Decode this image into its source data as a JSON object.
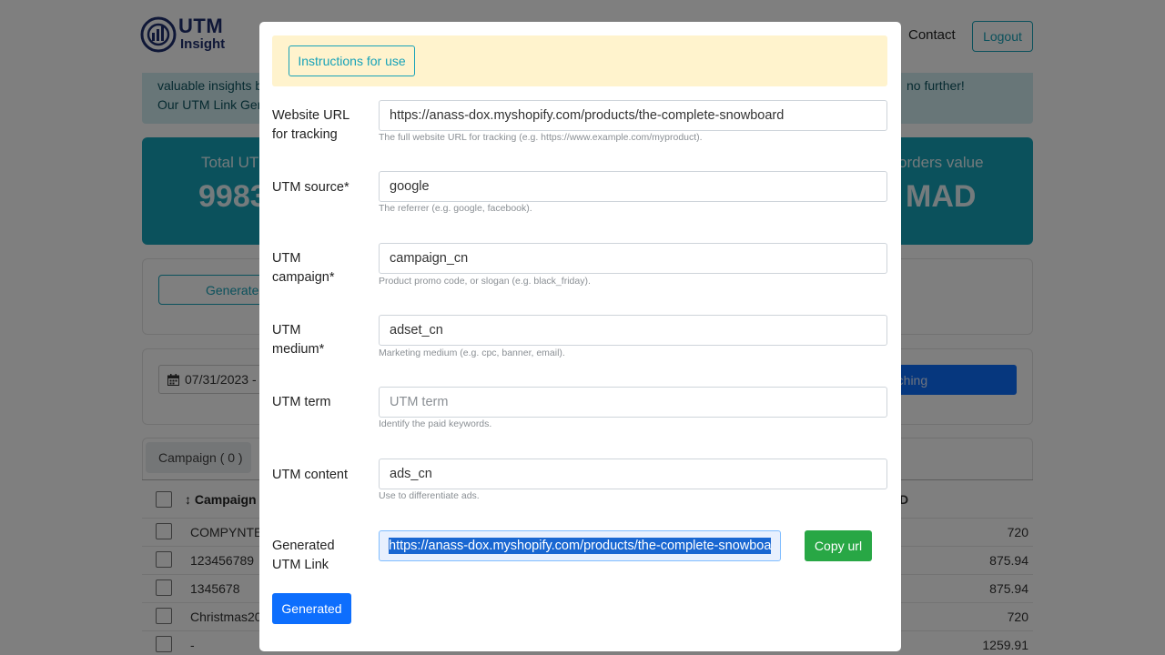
{
  "header": {
    "logo_line1": "UTM",
    "logo_line2": "Insight",
    "contact_label": "Contact",
    "logout_label": "Logout"
  },
  "intro": {
    "line1": "valuable insights b",
    "line2": "Our UTM Link Gen",
    "line3": "no further!"
  },
  "stats": {
    "left_label": "Total UT",
    "left_value": "9983",
    "right_label": "orders value",
    "right_value": "MAD"
  },
  "toolbar": {
    "generate_label": "Generate",
    "date_value": "07/31/2023 -",
    "search_label": "rching"
  },
  "tabs": {
    "campaign_label": "Campaign ( 0 )"
  },
  "table": {
    "header_campaign": "Campaign",
    "header_amount": "D",
    "rows": [
      {
        "name": "COMPYNTES",
        "amount": "720"
      },
      {
        "name": "123456789",
        "amount": "875.94"
      },
      {
        "name": "1345678",
        "amount": "875.94"
      },
      {
        "name": "Christmas20",
        "amount": "720"
      },
      {
        "name": "-",
        "amount": "1259.91"
      }
    ]
  },
  "modal": {
    "instructions_label": "Instructions for use",
    "fields": {
      "url": {
        "label": "Website URL for tracking",
        "value": "https://anass-dox.myshopify.com/products/the-complete-snowboard",
        "help": "The full website URL for tracking (e.g. https://www.example.com/myproduct)."
      },
      "source": {
        "label": "UTM source*",
        "value": "google",
        "help": "The referrer (e.g. google, facebook)."
      },
      "campaign": {
        "label": "UTM campaign*",
        "value": "campaign_cn",
        "help": "Product promo code, or slogan (e.g. black_friday)."
      },
      "medium": {
        "label": "UTM medium*",
        "value": "adset_cn",
        "help": "Marketing medium (e.g. cpc, banner, email)."
      },
      "term": {
        "label": "UTM term",
        "value": "",
        "placeholder": "UTM term",
        "help": "Identify the paid keywords."
      },
      "content": {
        "label": "UTM content",
        "value": "ads_cn",
        "help": "Use to differentiate ads."
      }
    },
    "generated_label": "Generated UTM Link",
    "generated_value": "https://anass-dox.myshopify.com/products/the-complete-snowboa",
    "copy_label": "Copy url",
    "generate_button_label": "Generated"
  },
  "colors": {
    "accent": "#17a2b8",
    "primary": "#0d6efd",
    "success": "#28a745",
    "notice": "#fff3cd"
  }
}
